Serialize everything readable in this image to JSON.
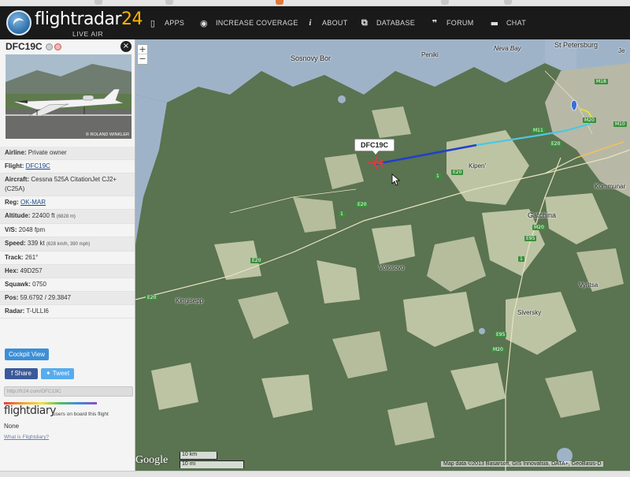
{
  "header": {
    "logo_text": "flightradar",
    "logo_number": "24",
    "logo_sub": "LIVE AIR TRAFFIC",
    "nav": [
      {
        "label": "APPS",
        "icon": "phone-icon"
      },
      {
        "label": "INCREASE COVERAGE",
        "icon": "eye-icon"
      },
      {
        "label": "ABOUT",
        "icon": "info-icon"
      },
      {
        "label": "DATABASE",
        "icon": "database-icon"
      },
      {
        "label": "FORUM",
        "icon": "quote-icon"
      },
      {
        "label": "CHAT",
        "icon": "chat-bubble-icon"
      }
    ]
  },
  "map": {
    "zoom_in": "+",
    "zoom_out": "−",
    "flight_label": "DFC19C",
    "places": [
      "Sosnovy Bor",
      "Peniki",
      "Neva Bay",
      "St Petersburg",
      "Kipen'",
      "Gatchina",
      "Kommunar",
      "Volosovo",
      "Kingisepp",
      "Vyritsa",
      "Siversky",
      "Je"
    ],
    "roads": [
      "M18",
      "M10",
      "M11",
      "M20",
      "E20",
      "E20",
      "E20",
      "E20",
      "E20",
      "E95",
      "E95",
      "M20",
      "M20",
      "1",
      "1",
      "1"
    ],
    "google": "Google",
    "scale_km": "10 km",
    "scale_mi": "10 mi",
    "attribution": "Map data ©2013 Basarsoft, GIS Innovatsia, DATA+, GeoBasis-D",
    "colors": {
      "land": "#5a7350",
      "water": "#9fb3c8",
      "track_blue": "#1f3fd0",
      "track_cyan": "#4cc7e0",
      "track_yellow": "#d9e53a",
      "aircraft": "#e03a3a"
    }
  },
  "panel": {
    "callsign": "DFC19C",
    "photo_credit": "© ROLAND WINKLER",
    "rows": [
      {
        "label": "Airline:",
        "value": "Private owner"
      },
      {
        "label": "Flight:",
        "value": "DFC19C"
      },
      {
        "label": "Aircraft:",
        "value": "Cessna 525A CitationJet CJ2+ (C25A)"
      },
      {
        "label": "Reg:",
        "value": "OK-MAR"
      },
      {
        "label": "Altitude:",
        "value": "22400 ft",
        "extra": "(6828 m)"
      },
      {
        "label": "V/S:",
        "value": "2048 fpm"
      },
      {
        "label": "Speed:",
        "value": "339 kt",
        "extra": "(628 km/h, 390 mph)"
      },
      {
        "label": "Track:",
        "value": "261°"
      },
      {
        "label": "Hex:",
        "value": "49D257"
      },
      {
        "label": "Squawk:",
        "value": "0750"
      },
      {
        "label": "Pos:",
        "value": "59.6792 / 29.3847"
      },
      {
        "label": "Radar:",
        "value": "T-ULLI6"
      }
    ],
    "cockpit_button": "Cockpit View",
    "share_button": "Share",
    "tweet_button": "Tweet",
    "share_url": "http://fr24.com/DFC19C",
    "flightdiary_logo": "flightdiary",
    "flightdiary_text": "users on board this flight",
    "flightdiary_value": "None",
    "flightdiary_link": "What is Flightdiary?"
  }
}
